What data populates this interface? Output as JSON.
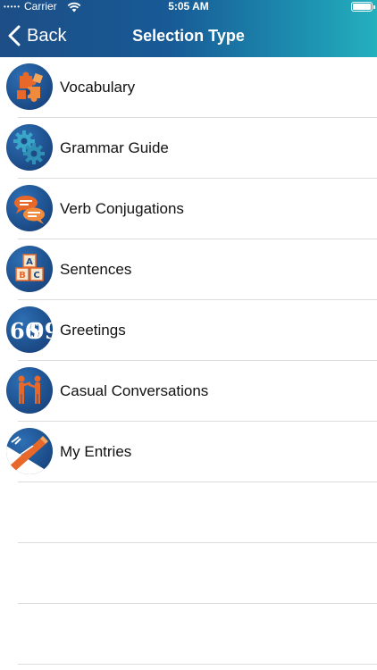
{
  "status_bar": {
    "carrier": "Carrier",
    "time": "5:05 AM"
  },
  "nav": {
    "back_label": "Back",
    "title": "Selection Type"
  },
  "items": [
    {
      "label": "Vocabulary",
      "icon": "puzzle-icon"
    },
    {
      "label": "Grammar Guide",
      "icon": "gears-icon"
    },
    {
      "label": "Verb Conjugations",
      "icon": "speech-bubbles-icon"
    },
    {
      "label": "Sentences",
      "icon": "abc-blocks-icon"
    },
    {
      "label": "Greetings",
      "icon": "quote-marks-icon"
    },
    {
      "label": "Casual Conversations",
      "icon": "people-talking-icon"
    },
    {
      "label": "My Entries",
      "icon": "pencil-icon"
    }
  ],
  "colors": {
    "nav_gradient_start": "#1d4e86",
    "nav_gradient_end": "#24b0bd",
    "icon_blue": "#1b4a86",
    "icon_orange": "#e8682a",
    "separator": "#dcdcdc"
  }
}
